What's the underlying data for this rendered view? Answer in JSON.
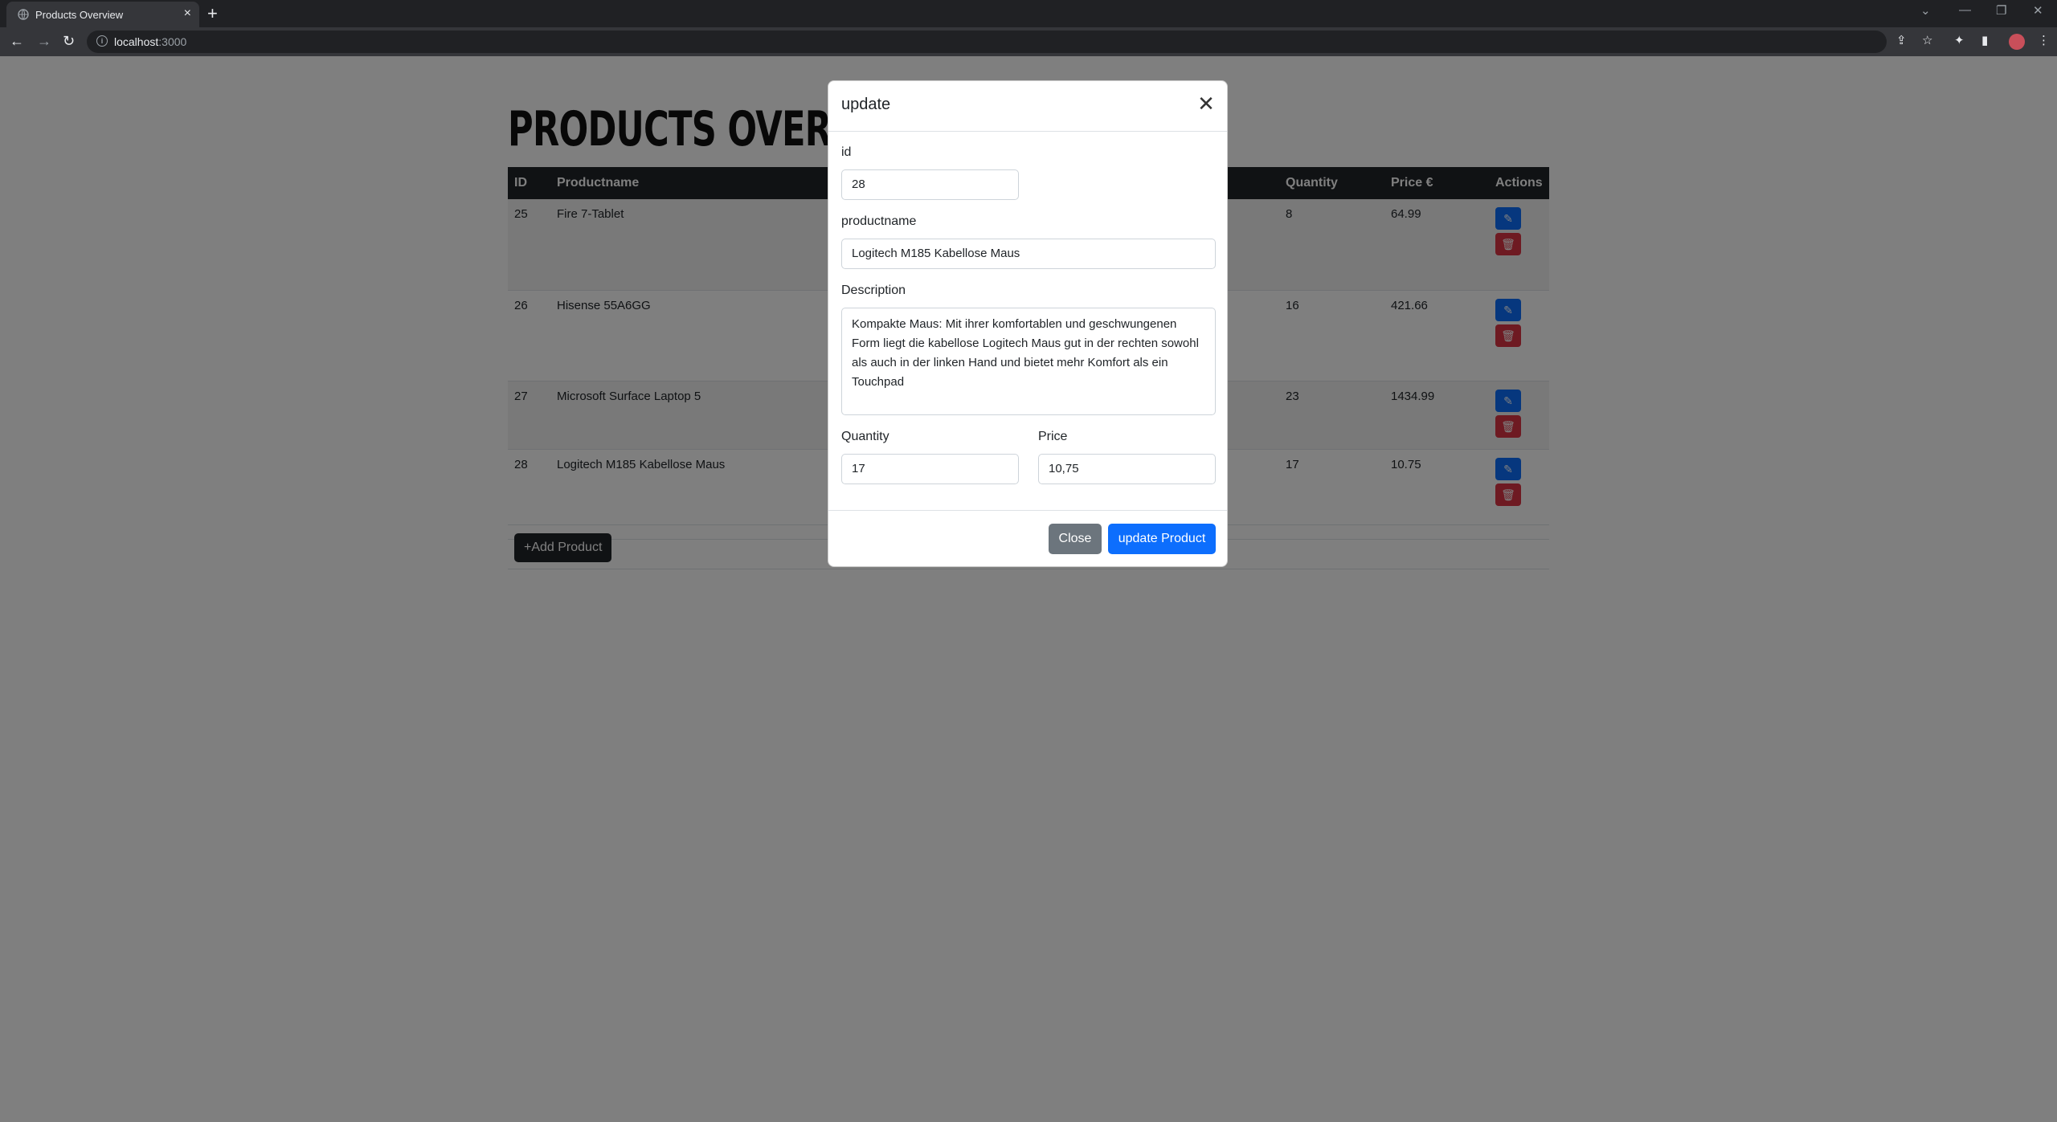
{
  "browser": {
    "tab_title": "Products Overview",
    "url_host": "localhost",
    "url_port": ":3000"
  },
  "page": {
    "title": "Products Overview",
    "columns": [
      "ID",
      "Productname",
      "Quantity",
      "Price €",
      "Actions"
    ],
    "rows": [
      {
        "id": "25",
        "name": "Fire 7-Tablet",
        "qty": "8",
        "price": "64.99"
      },
      {
        "id": "26",
        "name": "Hisense 55A6GG",
        "qty": "16",
        "price": "421.66"
      },
      {
        "id": "27",
        "name": "Microsoft Surface Laptop 5",
        "qty": "23",
        "price": "1434.99"
      },
      {
        "id": "28",
        "name": "Logitech M185 Kabellose Maus",
        "qty": "17",
        "price": "10.75"
      }
    ],
    "add_button": "+Add Product"
  },
  "modal": {
    "title": "update",
    "id_label": "id",
    "id_value": "28",
    "name_label": "productname",
    "name_value": "Logitech M185 Kabellose Maus",
    "desc_label": "Description",
    "desc_value": "Kompakte Maus: Mit ihrer komfortablen und geschwungenen Form liegt die kabellose Logitech Maus gut in der rechten sowohl als auch in der linken Hand und bietet mehr Komfort als ein Touchpad",
    "qty_label": "Quantity",
    "qty_value": "17",
    "price_label": "Price",
    "price_value": "10,75",
    "close_button": "Close",
    "update_button": "update Product"
  }
}
